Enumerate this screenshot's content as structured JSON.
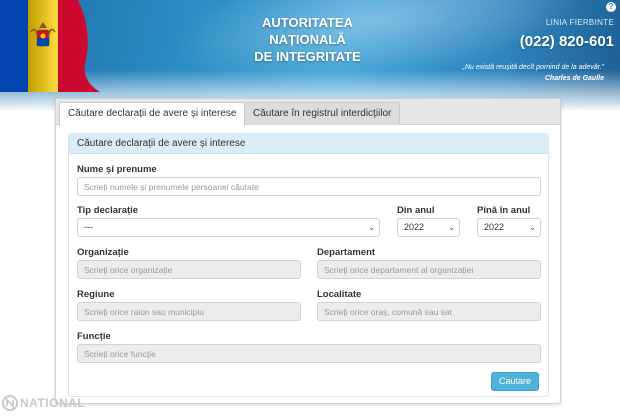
{
  "header": {
    "title_lines": [
      "AUTORITATEA",
      "NAȚIONALĂ",
      "DE INTEGRITATE"
    ],
    "hotline_label": "LINIA FIERBINTE",
    "hotline_number": "(022) 820-601",
    "quote": "„Nu există reușită decît pornind de la adevăr.”",
    "quote_author": "Charles de Gaulle",
    "help_symbol": "?"
  },
  "tabs": [
    {
      "label": "Căutare declarații de avere și interese",
      "active": true
    },
    {
      "label": "Căutare în registrul interdicțiilor",
      "active": false
    }
  ],
  "form": {
    "title": "Căutare declarații de avere și interese",
    "name": {
      "label": "Nume și prenume",
      "placeholder": "Scrieți numele și prenumele persoanei căutate"
    },
    "type": {
      "label": "Tip declarație",
      "value": "---"
    },
    "from_year": {
      "label": "Din anul",
      "value": "2022"
    },
    "to_year": {
      "label": "Pînă în anul",
      "value": "2022"
    },
    "organization": {
      "label": "Organizație",
      "placeholder": "Scrieți orice organizație"
    },
    "department": {
      "label": "Departament",
      "placeholder": "Scrieți orice departament al organizației"
    },
    "region": {
      "label": "Regiune",
      "placeholder": "Scrieți orice raion sau municipiu"
    },
    "locality": {
      "label": "Localitate",
      "placeholder": "Scrieți orice oraș, comună sau sat"
    },
    "function": {
      "label": "Funcție",
      "placeholder": "Scrieți orice funcție"
    },
    "search_button": "Cautare"
  },
  "watermark": {
    "brand": "NATIONAL",
    "prefix": "Ⓡ"
  },
  "icons": {
    "flag": "moldova-flag-icon",
    "chevron": "chevron-down-icon",
    "help": "help-icon"
  },
  "colors": {
    "header_blue": "#2c8cc4",
    "card_header": "#d9ecf8",
    "button": "#4fb3d9",
    "flag_blue": "#0046ae",
    "flag_yellow": "#ffd200",
    "flag_red": "#cc092f"
  }
}
